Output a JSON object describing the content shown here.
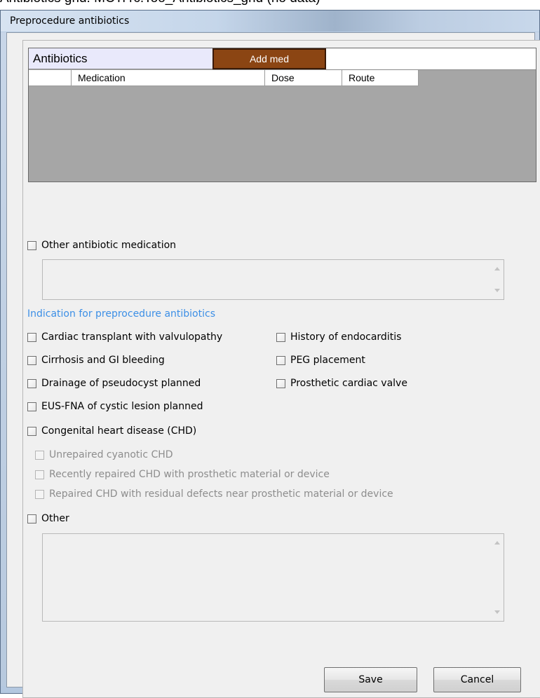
{
  "caption": "Antibiotics grid: MCTi rc.Too_Antibiotics_grid (no data)",
  "window": {
    "title": "Preprocedure antibiotics"
  },
  "antibiotics": {
    "title": "Antibiotics",
    "add_label": "Add med",
    "columns": [
      "",
      "Medication",
      "Dose",
      "Route"
    ]
  },
  "other_medication": {
    "label": "Other antibiotic medication",
    "value": ""
  },
  "indication": {
    "heading": "Indication for preprocedure antibiotics",
    "left": [
      "Cardiac transplant with valvulopathy",
      "Cirrhosis and GI bleeding",
      "Drainage of pseudocyst planned",
      "EUS-FNA of cystic lesion planned",
      "Congenital heart disease (CHD)"
    ],
    "right": [
      "History of endocarditis",
      "PEG placement",
      "Prosthetic cardiac valve"
    ],
    "chd_sub": [
      "Unrepaired cyanotic CHD",
      "Recently repaired CHD with prosthetic material or device",
      "Repaired CHD with residual defects near prosthetic material or device"
    ],
    "other_label": "Other",
    "other_value": ""
  },
  "buttons": {
    "save": "Save",
    "cancel": "Cancel"
  },
  "colors": {
    "add_button": "#8b4513",
    "section_label": "#3c8fe6",
    "grid_body": "#a6a6a6",
    "grid_title_bg": "#e9e9fb"
  }
}
